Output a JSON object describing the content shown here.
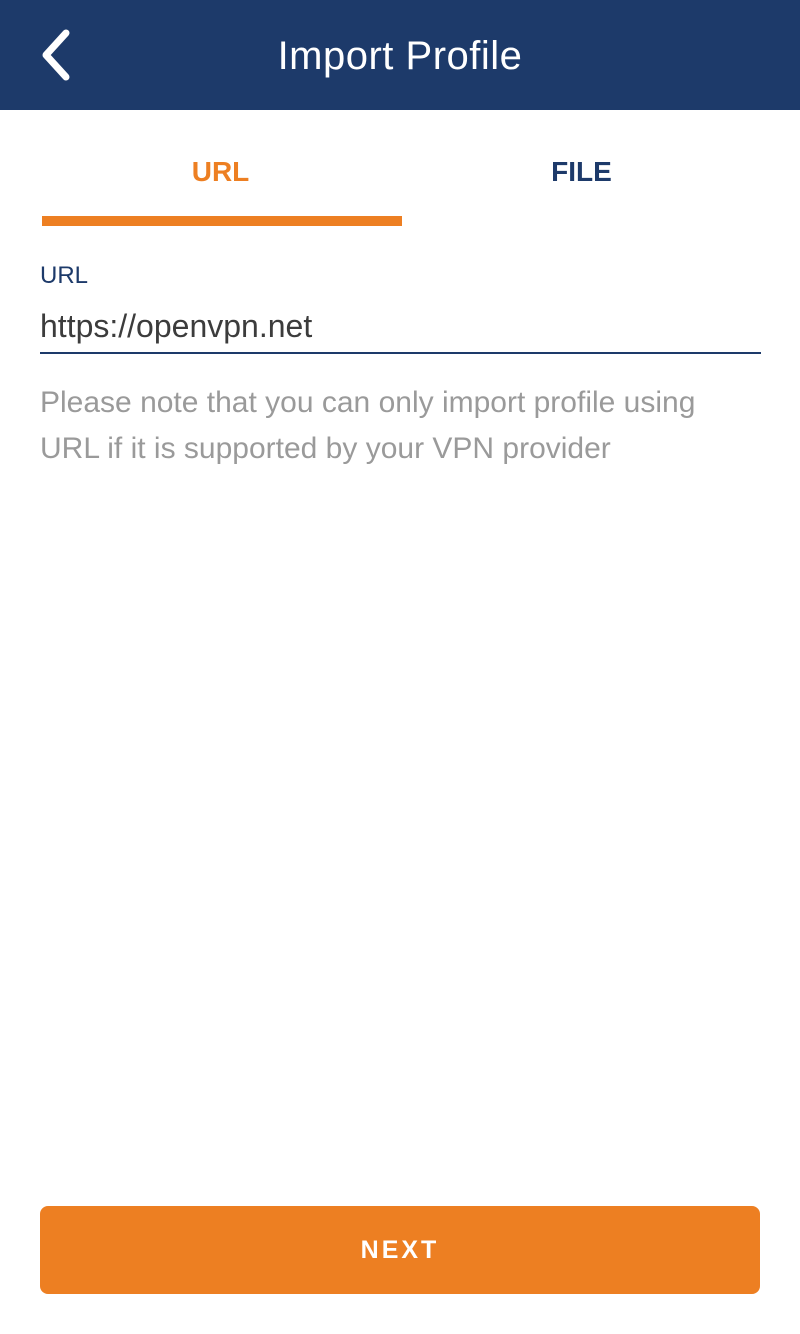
{
  "header": {
    "title": "Import Profile",
    "back_icon": "chevron-left-icon"
  },
  "tabs": [
    {
      "label": "URL",
      "active": true
    },
    {
      "label": "FILE",
      "active": false
    }
  ],
  "form": {
    "url_label": "URL",
    "url_value": "https://openvpn.net",
    "note": "Please note that you can only import profile using URL if it is supported by your VPN provider"
  },
  "actions": {
    "next_label": "NEXT"
  },
  "colors": {
    "header_bg": "#1d3a6a",
    "accent": "#ed7f22",
    "navy_text": "#1d3a6a",
    "note_text": "#9a9a9a"
  }
}
